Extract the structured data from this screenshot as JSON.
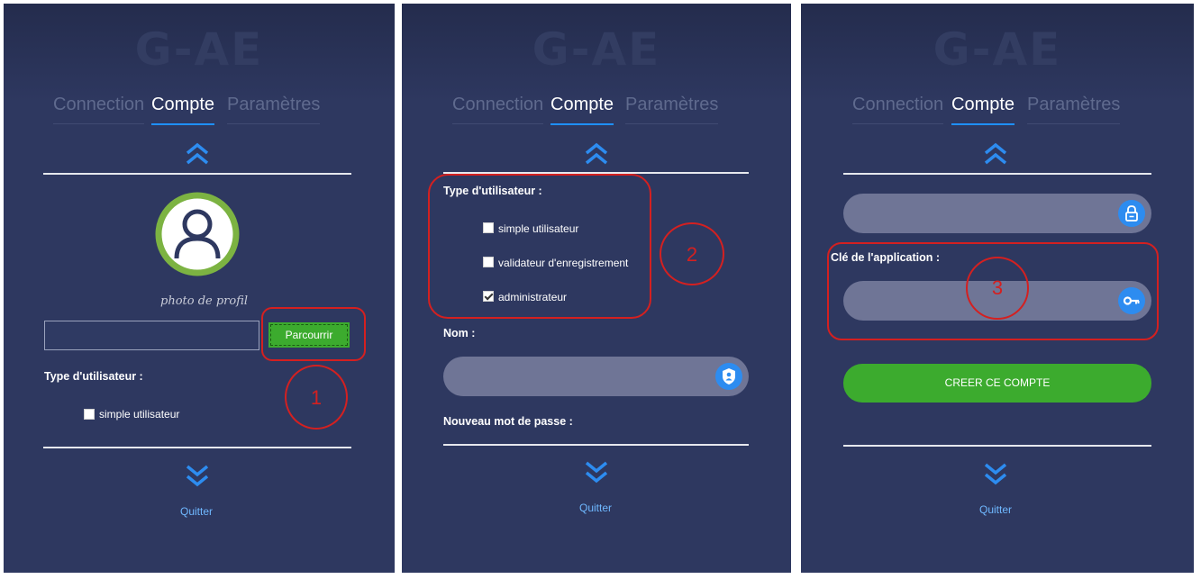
{
  "app": {
    "logo": "G-AE"
  },
  "tabs": {
    "connection": "Connection",
    "compte": "Compte",
    "parametres": "Paramètres"
  },
  "colors": {
    "panel_background": "#2e3860",
    "tab_active_underline": "#1e90ff",
    "chevron": "#2d8cf0",
    "button_green": "#3cab2e",
    "input_pill": "#6f7596",
    "annotation_red": "#d42020",
    "avatar_ring": "#7cb342"
  },
  "panel1": {
    "profile_caption": "photo de profil",
    "file_path_value": "",
    "browse_button": "Parcourrir",
    "user_type_label": "Type d'utilisateur :",
    "options": [
      {
        "label": "simple utilisateur",
        "checked": false
      }
    ],
    "quit": "Quitter",
    "annotation": "1",
    "icons": {
      "avatar": "user-avatar-icon",
      "scroll_up": "chevron-double-up-icon",
      "scroll_down": "chevron-double-down-icon"
    }
  },
  "panel2": {
    "user_type_label": "Type d'utilisateur :",
    "options": [
      {
        "label": "simple utilisateur",
        "checked": false
      },
      {
        "label": "validateur d'enregistrement",
        "checked": false
      },
      {
        "label": "administrateur",
        "checked": true
      }
    ],
    "name_label": "Nom :",
    "name_value": "",
    "new_password_label": "Nouveau mot de passe :",
    "quit": "Quitter",
    "annotation": "2",
    "icons": {
      "name_field": "shield-user-icon"
    }
  },
  "panel3": {
    "password_value": "",
    "app_key_label": "Clé de l'application :",
    "app_key_value": "",
    "create_button": "CREER CE COMPTE",
    "quit": "Quitter",
    "annotation": "3",
    "icons": {
      "password_field": "lock-icon",
      "key_field": "key-icon"
    }
  }
}
